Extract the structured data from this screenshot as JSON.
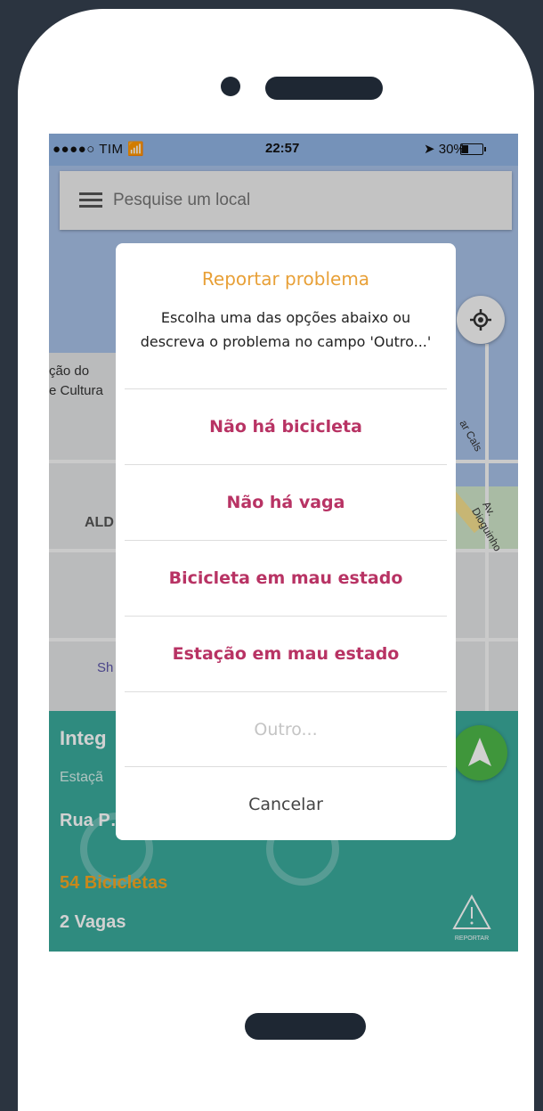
{
  "status_bar": {
    "carrier": "●●●●○ TIM",
    "time": "22:57",
    "battery": "30%"
  },
  "search": {
    "placeholder": "Pesquise um local"
  },
  "map": {
    "labels": [
      "ção do",
      "e Cultura",
      "ALD",
      "Sh",
      "ar Cals",
      "Av. Dioguinho"
    ]
  },
  "station": {
    "name": "Integ",
    "type": "Estaçã",
    "address": "Rua P… do Terminal Papicu",
    "bikes": "54 Bicicletas",
    "docks": "2 Vagas",
    "report_label": "REPORTAR"
  },
  "dialog": {
    "title": "Reportar problema",
    "message": "Escolha uma das opções abaixo ou descreva o problema no campo 'Outro...'",
    "options": [
      "Não há bicicleta",
      "Não há vaga",
      "Bicicleta em mau estado",
      "Estação em mau estado"
    ],
    "other": "Outro...",
    "cancel": "Cancelar"
  },
  "colors": {
    "accent_title": "#e8a037",
    "option_text": "#b83364",
    "panel": "#3aaa9c",
    "nav_button": "#4db848",
    "bikes_text": "#f4a623"
  },
  "icons": [
    "wifi-icon",
    "location-arrow-icon",
    "battery-icon",
    "menu-icon",
    "locate-icon",
    "navigation-icon",
    "warning-icon"
  ]
}
